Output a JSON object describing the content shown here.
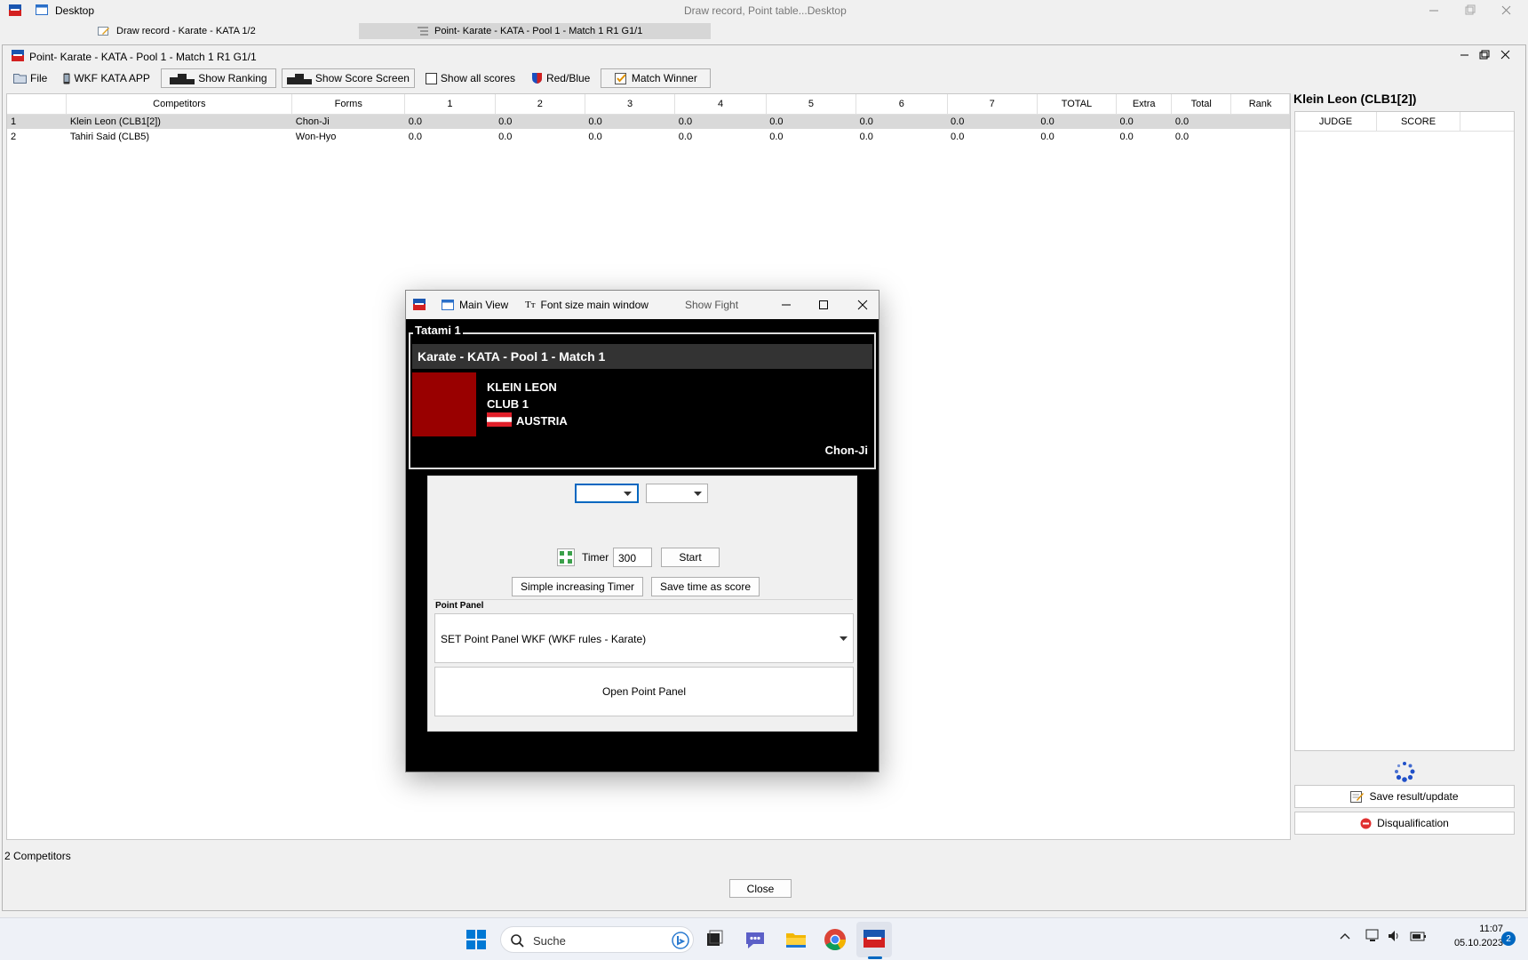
{
  "desktop": {
    "title": "Desktop",
    "center_title": "Draw record, Point table...Desktop",
    "tabs": [
      {
        "label": "Draw record - Karate - KATA 1/2"
      },
      {
        "label": "Point- Karate - KATA - Pool 1 - Match 1 R1 G1/1"
      }
    ]
  },
  "window": {
    "title": "Point- Karate - KATA - Pool 1 - Match 1 R1 G1/1",
    "toolbar": {
      "file": "File",
      "wkf_app": "WKF KATA APP",
      "show_ranking": "Show Ranking",
      "show_score_screen": "Show Score Screen",
      "show_all_scores": "Show all scores",
      "red_blue": "Red/Blue",
      "match_winner": "Match Winner"
    },
    "grid": {
      "headers": [
        "",
        "Competitors",
        "Forms",
        "1",
        "2",
        "3",
        "4",
        "5",
        "6",
        "7",
        "TOTAL",
        "Extra",
        "Total",
        "Rank"
      ],
      "rows": [
        {
          "no": "1",
          "name": "Klein Leon (CLB1[2])",
          "form": "Chon-Ji",
          "s1": "0.0",
          "s2": "0.0",
          "s3": "0.0",
          "s4": "0.0",
          "s5": "0.0",
          "s6": "0.0",
          "s7": "0.0",
          "total": "0.0",
          "extra": "0.0",
          "total2": "0.0",
          "rank": ""
        },
        {
          "no": "2",
          "name": "Tahiri Said (CLB5)",
          "form": "Won-Hyo",
          "s1": "0.0",
          "s2": "0.0",
          "s3": "0.0",
          "s4": "0.0",
          "s5": "0.0",
          "s6": "0.0",
          "s7": "0.0",
          "total": "0.0",
          "extra": "0.0",
          "total2": "0.0",
          "rank": ""
        }
      ]
    },
    "right_panel": {
      "heading": "Klein Leon (CLB1[2])",
      "judge_header": "JUDGE",
      "score_header": "SCORE",
      "save_button": "Save result/update",
      "disqualification_button": "Disqualification"
    },
    "status": "2 Competitors",
    "close_button": "Close"
  },
  "dialog": {
    "menu": {
      "main_view": "Main View",
      "font_size": "Font size main window",
      "show_fight": "Show Fight"
    },
    "tatami": "Tatami 1",
    "match_title": "Karate - KATA - Pool 1 - Match 1",
    "competitor": {
      "name": "KLEIN LEON",
      "club": "CLUB 1",
      "country": "AUSTRIA",
      "form": "Chon-Ji"
    },
    "timer_label": "Timer",
    "timer_value": "300",
    "start_button": "Start",
    "simple_timer_button": "Simple increasing Timer",
    "save_time_button": "Save time as score",
    "point_panel_label": "Point Panel",
    "point_panel_select": "SET Point Panel WKF (WKF rules - Karate)",
    "open_point_panel_button": "Open Point Panel"
  },
  "taskbar": {
    "search_placeholder": "Suche",
    "time": "11:07",
    "date": "05.10.2023",
    "notification_count": "2"
  },
  "colors": {
    "competitor_red": "#990000",
    "accent_blue": "#0067c0"
  }
}
